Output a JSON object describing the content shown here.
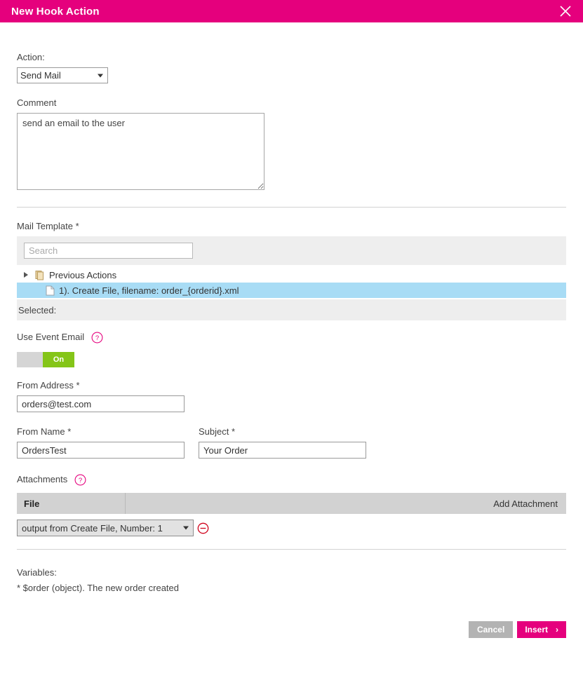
{
  "dialog": {
    "title": "New Hook Action",
    "close_icon": "close-icon"
  },
  "colors": {
    "header_bg": "#e5007d",
    "accent": "#e5007d",
    "toggle_on": "#84c518",
    "tree_selected": "#a8dcf5",
    "panel_bg": "#eeeeee",
    "table_header_bg": "#d2d2d2",
    "cancel_bg": "#b3b3b3",
    "remove_icon": "#d0021b"
  },
  "action": {
    "label": "Action:",
    "value": "Send Mail",
    "options": [
      "Send Mail"
    ]
  },
  "comment": {
    "label": "Comment",
    "value": "send an email to the user",
    "placeholder": ""
  },
  "mail_template": {
    "label": "Mail Template *",
    "search": {
      "value": "",
      "placeholder": "Search"
    },
    "tree": [
      {
        "label": "Previous Actions",
        "icon": "folder-icon",
        "expanded": true,
        "selected": false
      },
      {
        "label": "1). Create File, filename: order_{orderid}.xml",
        "icon": "file-icon",
        "expanded": false,
        "selected": true
      }
    ],
    "selected_label": "Selected:",
    "selected_value": ""
  },
  "use_event_email": {
    "label": "Use Event Email",
    "help_icon": "help-icon",
    "state": "On",
    "on": true
  },
  "from_address": {
    "label": "From Address *",
    "value": "orders@test.com",
    "placeholder": ""
  },
  "from_name": {
    "label": "From Name *",
    "value": "OrdersTest",
    "placeholder": ""
  },
  "subject": {
    "label": "Subject *",
    "value": "Your Order",
    "placeholder": ""
  },
  "attachments": {
    "label": "Attachments",
    "help_icon": "help-icon",
    "columns": [
      "File",
      ""
    ],
    "add_label": "Add Attachment",
    "rows": [
      {
        "value": "output from Create File, Number: 1",
        "options": [
          "output from Create File, Number: 1"
        ],
        "remove_icon": "remove-circle-icon"
      }
    ]
  },
  "variables": {
    "title": "Variables:",
    "items": [
      "* $order (object). The new order created"
    ]
  },
  "footer": {
    "cancel_label": "Cancel",
    "insert_label": "Insert",
    "insert_chevron": "›"
  }
}
